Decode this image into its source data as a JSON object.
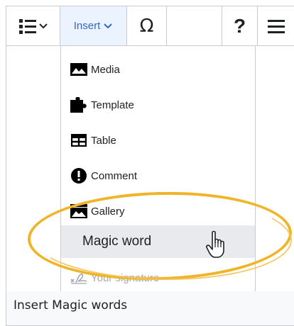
{
  "toolbar": {
    "list_icon": "bulleted-list-icon",
    "insert_label": "Insert",
    "omega_label": "Ω",
    "help_label": "?",
    "menu_icon": "hamburger-menu-icon"
  },
  "insert_menu": {
    "items": [
      {
        "label": "Media",
        "icon": "image-icon"
      },
      {
        "label": "Template",
        "icon": "puzzle-icon"
      },
      {
        "label": "Table",
        "icon": "table-icon"
      },
      {
        "label": "Comment",
        "icon": "exclamation-icon"
      },
      {
        "label": "Gallery",
        "icon": "gallery-icon"
      },
      {
        "label": "Magic word",
        "icon": ""
      },
      {
        "label": "Your signature",
        "icon": "signature-icon"
      }
    ],
    "highlighted": "Magic word"
  },
  "caption": "Insert Magic words",
  "colors": {
    "accent": "#3366cc",
    "highlight_ring": "#f0b428",
    "border": "#c8ccd1"
  }
}
